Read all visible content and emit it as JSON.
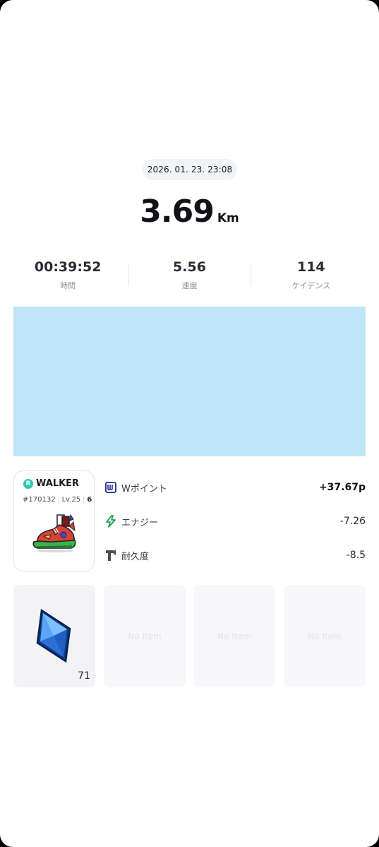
{
  "activity": {
    "datetime": "2026. 01. 23. 23:08",
    "distance": "3.69",
    "distance_unit": "Km"
  },
  "stats": [
    {
      "value": "00:39:52",
      "label": "時間"
    },
    {
      "value": "5.56",
      "label": "速度"
    },
    {
      "value": "114",
      "label": "ケイデンス"
    }
  ],
  "nft": {
    "brand_badge": "R",
    "brand": "WALKER",
    "id": "#170132",
    "level": "Lv.25",
    "extra": "6"
  },
  "rewards": [
    {
      "icon": "w-point-icon",
      "name": "Wポイント",
      "amount": "+37.67p"
    },
    {
      "icon": "energy-icon",
      "name": "エナジー",
      "amount": "-7.26"
    },
    {
      "icon": "durability-icon",
      "name": "耐久度",
      "amount": "-8.5"
    }
  ],
  "items": [
    {
      "icon": "blue-gem-icon",
      "count": "71"
    },
    {
      "empty_text": "No Item"
    },
    {
      "empty_text": "No Item"
    },
    {
      "empty_text": "No Item"
    }
  ],
  "colors": {
    "map_background": "#bfe6f7",
    "brand_accent": "#2ccab0",
    "energy_green": "#1a9e4b"
  }
}
